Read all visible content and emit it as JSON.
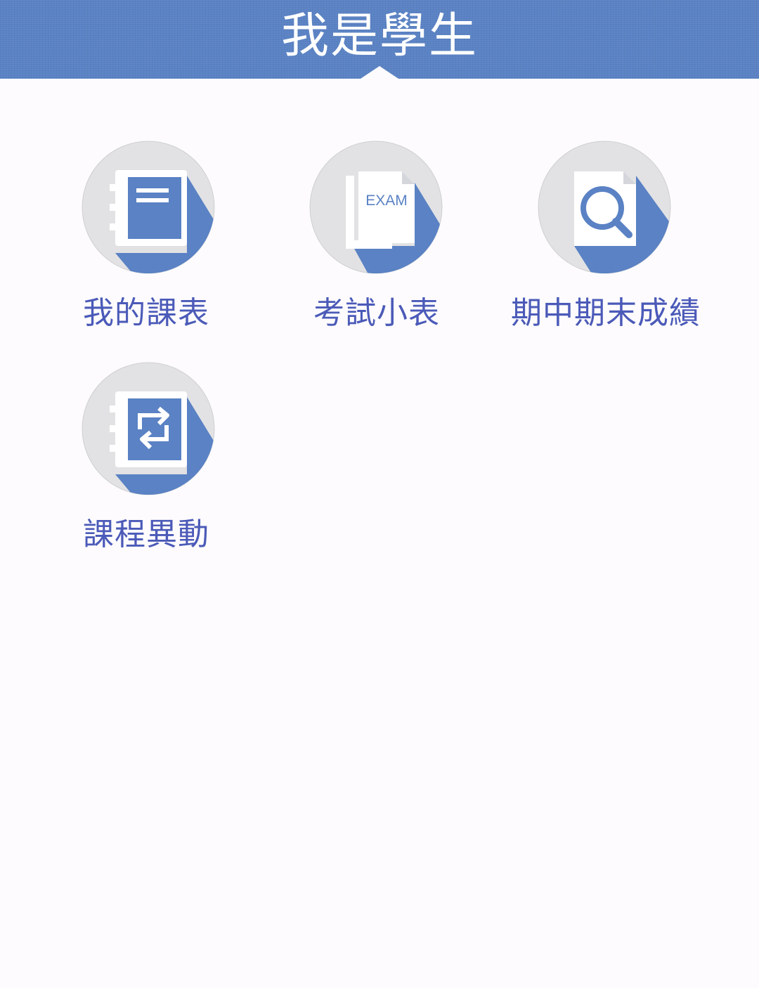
{
  "header": {
    "title": "我是學生"
  },
  "tiles": [
    {
      "label": "我的課表",
      "icon": "timetable-notebook-icon"
    },
    {
      "label": "考試小表",
      "icon": "exam-paper-icon"
    },
    {
      "label": "期中期末成績",
      "icon": "grades-search-icon"
    },
    {
      "label": "課程異動",
      "icon": "course-change-icon"
    }
  ],
  "colors": {
    "header_bg": "#5a82c4",
    "label_text": "#4b5ab8",
    "icon_blue": "#5a82c4",
    "icon_circle": "#e2e2e4",
    "background": "#fdfbfd"
  }
}
